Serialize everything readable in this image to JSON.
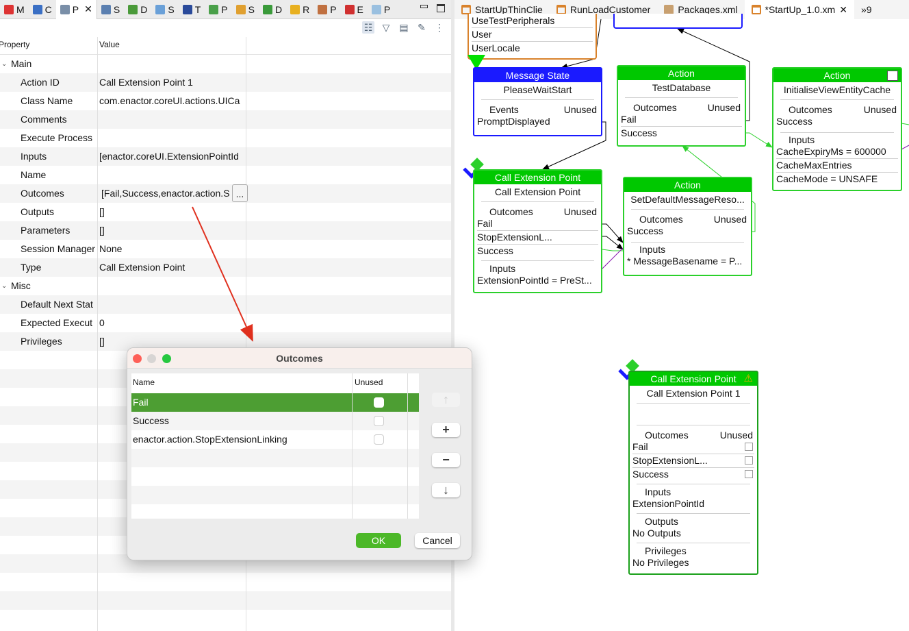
{
  "view_tabs": [
    {
      "label": "M",
      "color": "#d33"
    },
    {
      "label": "C",
      "color": "#3a6fc4"
    },
    {
      "label": "P",
      "color": "#7a8fa8",
      "active": true
    },
    {
      "label": "S",
      "color": "#5a7fb0"
    },
    {
      "label": "D",
      "color": "#4a9a3a"
    },
    {
      "label": "S",
      "color": "#6aa0d8"
    },
    {
      "label": "T",
      "color": "#2a4a9a"
    },
    {
      "label": "P",
      "color": "#4aa04a"
    },
    {
      "label": "S",
      "color": "#e0a030"
    },
    {
      "label": "D",
      "color": "#3a9a3a"
    },
    {
      "label": "R",
      "color": "#e8b020"
    },
    {
      "label": "P",
      "color": "#c07040"
    },
    {
      "label": "E",
      "color": "#d03030"
    },
    {
      "label": "P",
      "color": "#9ac0e0"
    }
  ],
  "properties": {
    "col_property": "Property",
    "col_value": "Value",
    "rows": [
      {
        "type": "cat",
        "label": "Main"
      },
      {
        "label": "Action ID",
        "value": "Call Extension Point 1"
      },
      {
        "label": "Class Name",
        "value": "com.enactor.coreUI.actions.UICa"
      },
      {
        "label": "Comments",
        "value": ""
      },
      {
        "label": "Execute Process",
        "value": ""
      },
      {
        "label": "Inputs",
        "value": "[enactor.coreUI.ExtensionPointId"
      },
      {
        "label": "Name",
        "value": ""
      },
      {
        "label": "Outcomes",
        "value": "[Fail,Success,enactor.action.S"
      },
      {
        "label": "Outputs",
        "value": "[]"
      },
      {
        "label": "Parameters",
        "value": "[]"
      },
      {
        "label": "Session Manager",
        "value": "None"
      },
      {
        "label": "Type",
        "value": "Call Extension Point"
      },
      {
        "type": "cat",
        "label": "Misc"
      },
      {
        "label": "Default Next Stat",
        "value": ""
      },
      {
        "label": "Expected Execut",
        "value": "0"
      },
      {
        "label": "Privileges",
        "value": "[]"
      }
    ],
    "ellipsis": "..."
  },
  "editor_tabs": [
    {
      "label": "StartUpThinClie"
    },
    {
      "label": "RunLoadCustomer"
    },
    {
      "label": "Packages.xml"
    },
    {
      "label": "*StartUp_1.0.xm",
      "active": true
    }
  ],
  "overflow": "»9",
  "diagram": {
    "top_node": {
      "items": [
        "UseTestPeripherals",
        "User",
        "UserLocale"
      ]
    },
    "message_state": {
      "header": "Message State",
      "title": "PleaseWaitStart",
      "events": "Events",
      "unused": "Unused",
      "items": [
        "PromptDisplayed"
      ]
    },
    "action_testdb": {
      "header": "Action",
      "title": "TestDatabase",
      "outcomes": "Outcomes",
      "unused": "Unused",
      "items": [
        "Fail",
        "Success"
      ]
    },
    "action_cache": {
      "header": "Action",
      "title": "InitialiseViewEntityCache",
      "outcomes": "Outcomes",
      "unused": "Unused",
      "items": [
        "Success"
      ],
      "inputs": "Inputs",
      "input_items": [
        "CacheExpiryMs = 600000",
        "CacheMaxEntries",
        "CacheMode = UNSAFE"
      ]
    },
    "cep1": {
      "header": "Call Extension Point",
      "title": "Call Extension Point",
      "outcomes": "Outcomes",
      "unused": "Unused",
      "items": [
        "Fail",
        "StopExtensionL...",
        "Success"
      ],
      "inputs": "Inputs",
      "input_items": [
        "ExtensionPointId = PreSt..."
      ]
    },
    "action_msg": {
      "header": "Action",
      "title": "SetDefaultMessageReso...",
      "outcomes": "Outcomes",
      "unused": "Unused",
      "items": [
        "Success"
      ],
      "inputs": "Inputs",
      "input_items": [
        "* MessageBasename = P..."
      ]
    },
    "cep2": {
      "header": "Call Extension Point",
      "title": "Call Extension Point 1",
      "outcomes": "Outcomes",
      "unused": "Unused",
      "items": [
        "Fail",
        "StopExtensionL...",
        "Success"
      ],
      "inputs": "Inputs",
      "input_items": [
        "ExtensionPointId"
      ],
      "outputs": "Outputs",
      "outputs_value": "No Outputs",
      "privileges": "Privileges",
      "privileges_value": "No Privileges"
    }
  },
  "dialog": {
    "title": "Outcomes",
    "col_name": "Name",
    "col_unused": "Unused",
    "rows": [
      {
        "name": "Fail",
        "unused": false,
        "selected": true
      },
      {
        "name": "Success",
        "unused": false
      },
      {
        "name": "enactor.action.StopExtensionLinking",
        "unused": false
      }
    ],
    "ok": "OK",
    "cancel": "Cancel"
  },
  "colors": {
    "node_green": "#00c800",
    "message_blue": "#1a1aff",
    "selection": "#4d9e33",
    "ok_green": "#4cb828",
    "annotation_arrow": "#e0301e"
  }
}
